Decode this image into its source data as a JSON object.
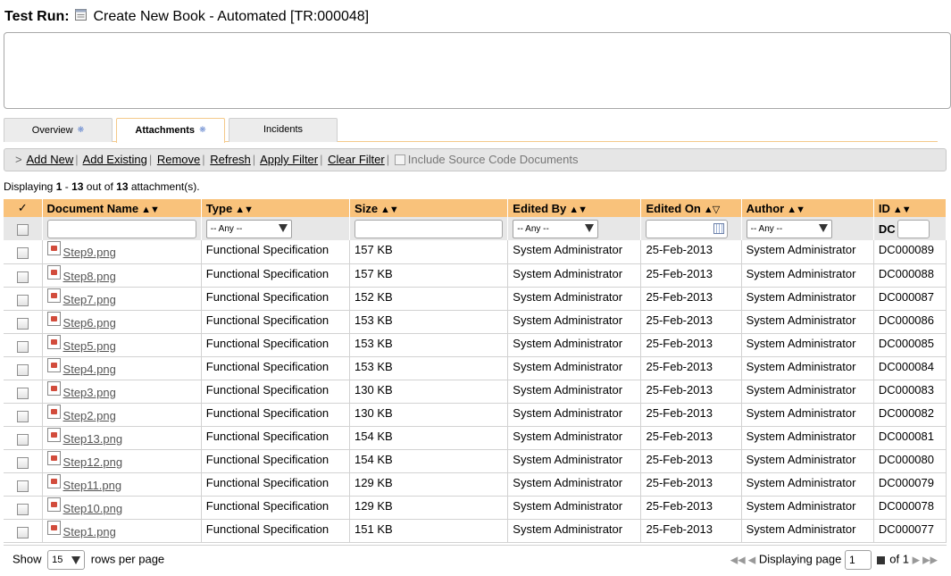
{
  "title": {
    "prefix": "Test Run:",
    "name": "Create New Book - Automated [TR:000048]",
    "icon": "document-icon"
  },
  "tabs": [
    {
      "label": "Overview",
      "has_star": true
    },
    {
      "label": "Attachments",
      "has_star": true,
      "active": true
    },
    {
      "label": "Incidents",
      "has_star": false
    }
  ],
  "tab_star": "❋",
  "toolbar": {
    "prefix": ">",
    "add_new": "Add New",
    "add_existing": "Add Existing",
    "remove": "Remove",
    "refresh": "Refresh",
    "apply_filter": "Apply Filter",
    "clear_filter": "Clear Filter",
    "include_source": "Include Source Code Documents"
  },
  "displaying": {
    "label": "Displaying",
    "from": "1",
    "to": "13",
    "out_of": "out of",
    "total": "13",
    "suffix": "attachment(s)."
  },
  "columns": {
    "check": "✓",
    "document_name": "Document Name",
    "type": "Type",
    "size": "Size",
    "edited_by": "Edited By",
    "edited_on": "Edited On",
    "author": "Author",
    "id": "ID"
  },
  "sort_arrows": "▲▼",
  "sort_arrows_edited_on": "▲▽",
  "filters": {
    "type_select": "-- Any --",
    "edited_by_select": "-- Any --",
    "author_select": "-- Any --",
    "id_prefix": "DC"
  },
  "rows": [
    {
      "name": "Step9.png",
      "type": "Functional Specification",
      "size": "157 KB",
      "edited_by": "System Administrator",
      "edited_on": "25-Feb-2013",
      "author": "System Administrator",
      "id": "DC000089"
    },
    {
      "name": "Step8.png",
      "type": "Functional Specification",
      "size": "157 KB",
      "edited_by": "System Administrator",
      "edited_on": "25-Feb-2013",
      "author": "System Administrator",
      "id": "DC000088"
    },
    {
      "name": "Step7.png",
      "type": "Functional Specification",
      "size": "152 KB",
      "edited_by": "System Administrator",
      "edited_on": "25-Feb-2013",
      "author": "System Administrator",
      "id": "DC000087"
    },
    {
      "name": "Step6.png",
      "type": "Functional Specification",
      "size": "153 KB",
      "edited_by": "System Administrator",
      "edited_on": "25-Feb-2013",
      "author": "System Administrator",
      "id": "DC000086"
    },
    {
      "name": "Step5.png",
      "type": "Functional Specification",
      "size": "153 KB",
      "edited_by": "System Administrator",
      "edited_on": "25-Feb-2013",
      "author": "System Administrator",
      "id": "DC000085"
    },
    {
      "name": "Step4.png",
      "type": "Functional Specification",
      "size": "153 KB",
      "edited_by": "System Administrator",
      "edited_on": "25-Feb-2013",
      "author": "System Administrator",
      "id": "DC000084"
    },
    {
      "name": "Step3.png",
      "type": "Functional Specification",
      "size": "130 KB",
      "edited_by": "System Administrator",
      "edited_on": "25-Feb-2013",
      "author": "System Administrator",
      "id": "DC000083"
    },
    {
      "name": "Step2.png",
      "type": "Functional Specification",
      "size": "130 KB",
      "edited_by": "System Administrator",
      "edited_on": "25-Feb-2013",
      "author": "System Administrator",
      "id": "DC000082"
    },
    {
      "name": "Step13.png",
      "type": "Functional Specification",
      "size": "154 KB",
      "edited_by": "System Administrator",
      "edited_on": "25-Feb-2013",
      "author": "System Administrator",
      "id": "DC000081"
    },
    {
      "name": "Step12.png",
      "type": "Functional Specification",
      "size": "154 KB",
      "edited_by": "System Administrator",
      "edited_on": "25-Feb-2013",
      "author": "System Administrator",
      "id": "DC000080"
    },
    {
      "name": "Step11.png",
      "type": "Functional Specification",
      "size": "129 KB",
      "edited_by": "System Administrator",
      "edited_on": "25-Feb-2013",
      "author": "System Administrator",
      "id": "DC000079"
    },
    {
      "name": "Step10.png",
      "type": "Functional Specification",
      "size": "129 KB",
      "edited_by": "System Administrator",
      "edited_on": "25-Feb-2013",
      "author": "System Administrator",
      "id": "DC000078"
    },
    {
      "name": "Step1.png",
      "type": "Functional Specification",
      "size": "151 KB",
      "edited_by": "System Administrator",
      "edited_on": "25-Feb-2013",
      "author": "System Administrator",
      "id": "DC000077"
    }
  ],
  "pager": {
    "show": "Show",
    "rows_per_page_value": "15",
    "rows_per_page": "rows per page",
    "first_prev": "◀◀ ◀",
    "displaying_page": "Displaying page",
    "page_value": "1",
    "of": "of 1",
    "next_last": "▶ ▶▶"
  },
  "colors": {
    "header_bg": "#f9c27b",
    "tab_border": "#f4c98a",
    "link": "#555555"
  }
}
